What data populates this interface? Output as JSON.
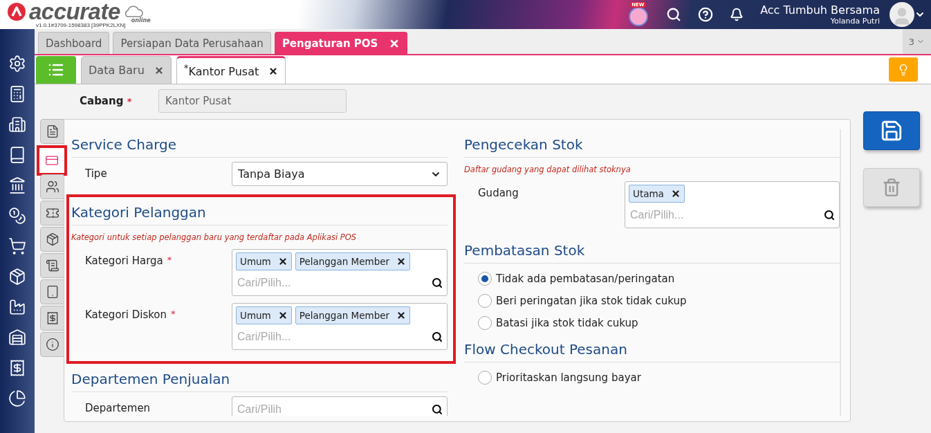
{
  "app": {
    "brand": "accurate",
    "brand_sub": "online",
    "version": "v1.0.1#3709-1598383 [39PPK2LXN]",
    "badge": "NEW",
    "company": "Acc Tumbuh Bersama",
    "user": "Yolanda Putri"
  },
  "sidebar": {
    "items": [
      {
        "kind": "settings"
      },
      {
        "kind": "register"
      },
      {
        "kind": "building"
      },
      {
        "kind": "book"
      },
      {
        "kind": "bank"
      },
      {
        "kind": "coins"
      },
      {
        "kind": "cart"
      },
      {
        "kind": "box"
      },
      {
        "kind": "factory"
      },
      {
        "kind": "warehouse"
      },
      {
        "kind": "receipt"
      },
      {
        "kind": "chart"
      }
    ]
  },
  "main_tabs": [
    {
      "label": "Dashboard",
      "selected": false,
      "closable": false
    },
    {
      "label": "Persiapan Data Perusahaan",
      "selected": false,
      "closable": false
    },
    {
      "label": "Pengaturan POS",
      "selected": true,
      "closable": true
    }
  ],
  "tab_count": "3",
  "sub_tabs": [
    {
      "label": "Data Baru",
      "selected": false
    },
    {
      "label": "$^{*}$Kantor Pusat",
      "selected": true
    }
  ],
  "branch": {
    "label": "Cabang",
    "mark": "*",
    "value": "Kantor Pusat"
  },
  "side_tabs": [
    {
      "kind": "document",
      "selected": false
    },
    {
      "kind": "card",
      "selected": true
    },
    {
      "kind": "users",
      "selected": false
    },
    {
      "kind": "ticket",
      "selected": false
    },
    {
      "kind": "box",
      "selected": false
    },
    {
      "kind": "scroll",
      "selected": false
    },
    {
      "kind": "tablet",
      "selected": false
    },
    {
      "kind": "receipt",
      "selected": false
    },
    {
      "kind": "info",
      "selected": false
    }
  ],
  "columns": [
    [
      {
        "title": "Service Charge",
        "highlighted": false,
        "fields": [
          {
            "kind": "select",
            "label": "Tipe",
            "value": "Tanpa Biaya"
          }
        ]
      },
      {
        "title": "Kategori Pelanggan",
        "highlighted": true,
        "note": "Kategori untuk setiap pelanggan baru yang terdaftar pada Aplikasi POS",
        "fields": [
          {
            "kind": "tags",
            "label": "Kategori Harga",
            "mark": "*",
            "tags": [
              "Umum",
              "Pelanggan Member"
            ],
            "placeholder": "Cari/Pilih..."
          },
          {
            "kind": "tags",
            "label": "Kategori Diskon",
            "mark": "*",
            "tags": [
              "Umum",
              "Pelanggan Member"
            ],
            "placeholder": "Cari/Pilih..."
          }
        ]
      },
      {
        "title": "Departemen Penjualan",
        "highlighted": false,
        "fields": [
          {
            "kind": "search",
            "label": "Departemen",
            "placeholder": "Cari/Pilih"
          }
        ]
      }
    ],
    [
      {
        "title": "Pengecekan Stok",
        "highlighted": false,
        "note": "Daftar gudang yang dapat dilihat stoknya",
        "fields": [
          {
            "kind": "tags",
            "label": "Gudang",
            "tags": [
              "Utama"
            ],
            "placeholder": "Cari/Pilih..."
          }
        ]
      },
      {
        "title": "Pembatasan Stok",
        "highlighted": false,
        "fields": [
          {
            "kind": "radio",
            "options": [
              {
                "label": "Tidak ada pembatasan/peringatan",
                "selected": true
              },
              {
                "label": "Beri peringatan jika stok tidak cukup",
                "selected": false
              },
              {
                "label": "Batasi jika stok tidak cukup",
                "selected": false
              }
            ]
          }
        ]
      },
      {
        "title": "Flow Checkout Pesanan",
        "highlighted": false,
        "fields": [
          {
            "kind": "radio",
            "options": [
              {
                "label": "Prioritaskan langsung bayar",
                "selected": false
              }
            ]
          }
        ]
      }
    ]
  ],
  "actions": [
    {
      "kind": "save",
      "disabled": false
    },
    {
      "kind": "delete",
      "disabled": true
    }
  ]
}
